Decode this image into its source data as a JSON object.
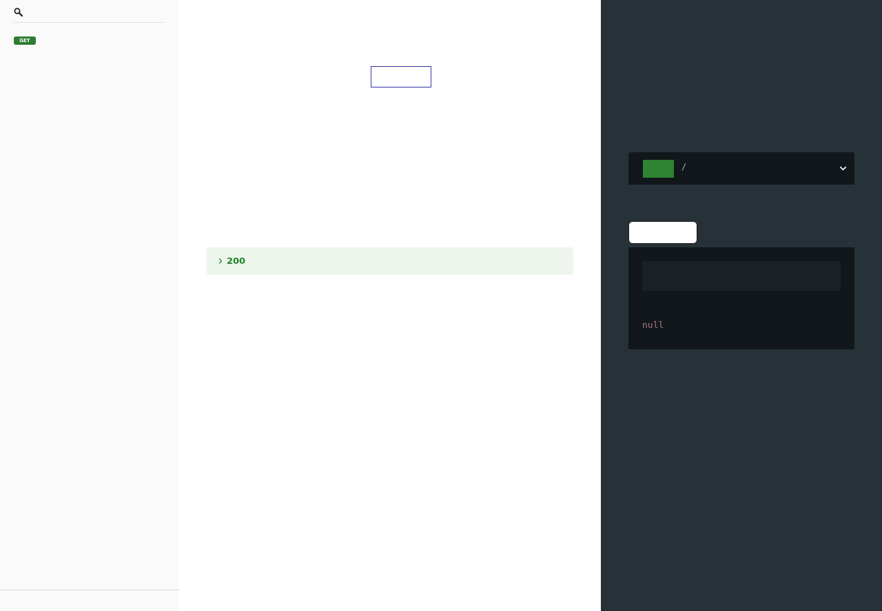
{
  "sidebar": {
    "items": [
      {
        "method": "GET",
        "selected": false
      }
    ]
  },
  "responses": [
    {
      "code": "200",
      "expanded": false
    }
  ],
  "endpoint": {
    "path": "/",
    "expanded": false
  },
  "sample": {
    "value": "null"
  }
}
